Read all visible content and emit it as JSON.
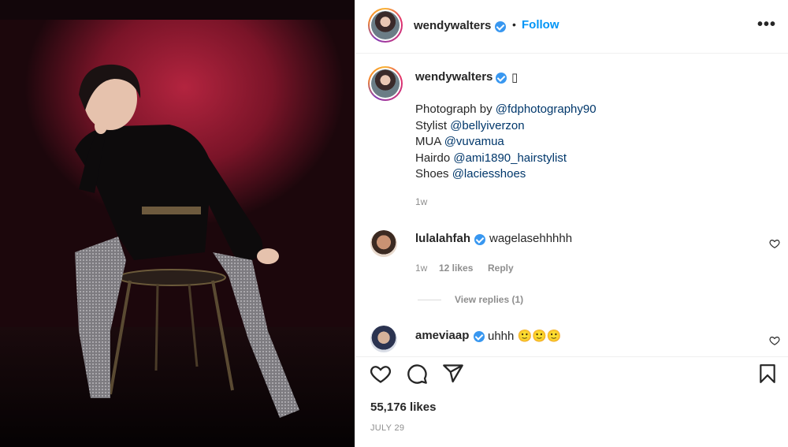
{
  "post": {
    "username": "wendywalters",
    "follow_label": "Follow",
    "separator": "•",
    "more_label": "•••"
  },
  "caption": {
    "username": "wendywalters",
    "emoji": "▯",
    "lines": [
      {
        "prefix": "Photograph by ",
        "mention": "@fdphotography90"
      },
      {
        "prefix": "Stylist ",
        "mention": "@bellyiverzon"
      },
      {
        "prefix": "MUA ",
        "mention": "@vuvamua"
      },
      {
        "prefix": "Hairdo ",
        "mention": "@ami1890_hairstylist"
      },
      {
        "prefix": "Shoes ",
        "mention": "@laciesshoes"
      }
    ],
    "time": "1w"
  },
  "comments": [
    {
      "username": "lulalahfah",
      "text": "wagelasehhhhh",
      "time": "1w",
      "likes": "12 likes",
      "reply_label": "Reply",
      "view_replies": "View replies (1)"
    },
    {
      "username": "ameviaap",
      "text": "uhhh 🙂🙂🙂"
    }
  ],
  "footer": {
    "likes": "55,176 likes",
    "date": "JULY 29"
  },
  "colors": {
    "accent": "#0095f6",
    "verified": "#3897f0",
    "mention": "#00376b",
    "muted": "#8e8e8e"
  },
  "icons": [
    "heart-icon",
    "comment-icon",
    "share-icon",
    "bookmark-icon",
    "verified-icon",
    "more-icon"
  ]
}
